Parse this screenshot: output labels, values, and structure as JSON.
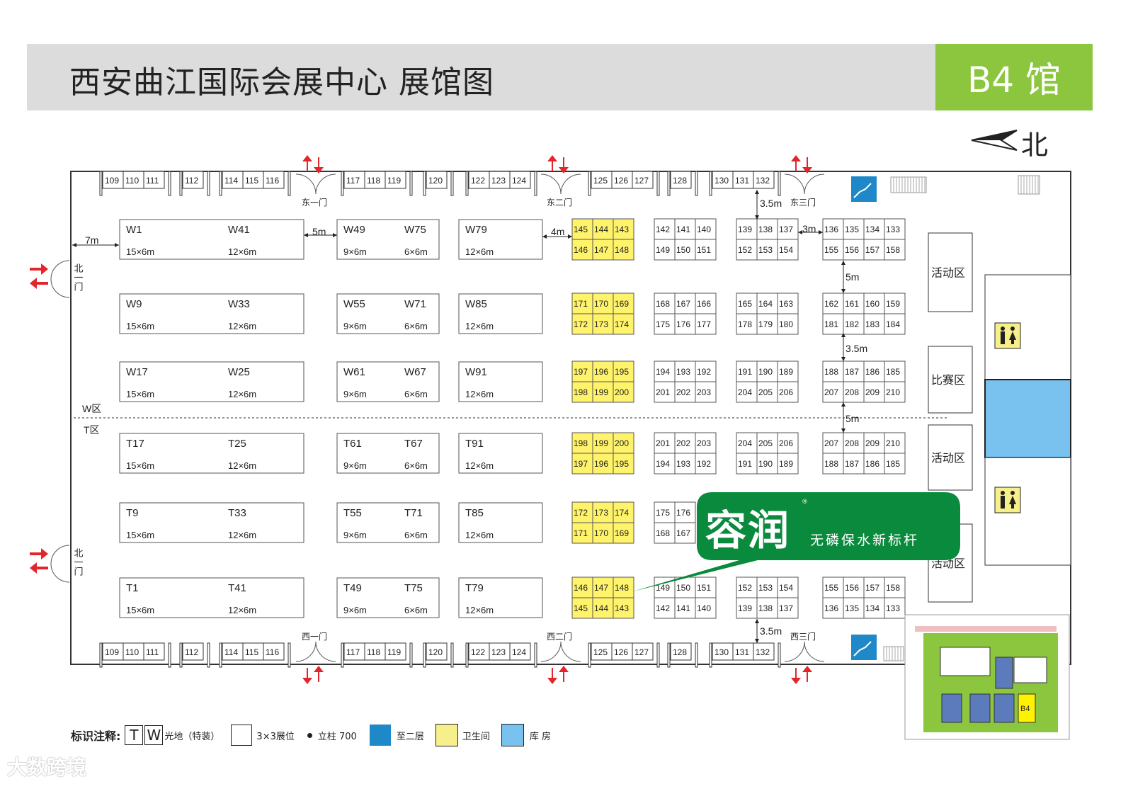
{
  "header": {
    "title": "西安曲江国际会展中心 展馆图",
    "hall": "B4 馆",
    "north_label": "北"
  },
  "colors": {
    "accent_green": "#8cc63f",
    "header_gray": "#dcdcdc",
    "booth_yellow": "#fff36b",
    "storage_blue": "#79c1ef",
    "stair_blue": "#1e88c8",
    "door_red": "#e3262b",
    "ad_green": "#0a8a3c"
  },
  "edge_booths": {
    "groups": [
      [
        "109",
        "110",
        "111"
      ],
      [
        "112"
      ],
      [
        "114",
        "115",
        "116"
      ],
      [
        "117",
        "118",
        "119"
      ],
      [
        "120"
      ],
      [
        "122",
        "123",
        "124"
      ],
      [
        "125",
        "126",
        "127"
      ],
      [
        "128"
      ],
      [
        "130",
        "131",
        "132"
      ]
    ]
  },
  "doors": {
    "east": [
      "东一门",
      "东二门",
      "东三门"
    ],
    "west": [
      "西一门",
      "西二门",
      "西三门"
    ],
    "north": [
      "北一门",
      "北一门"
    ]
  },
  "distances": {
    "d7": "7m",
    "d5": "5m",
    "d4": "4m",
    "d35": "3.5m",
    "d3": "3m"
  },
  "zones": {
    "w_label": "W区",
    "t_label": "T区",
    "activity": "活动区",
    "competition": "比赛区"
  },
  "large_booths": [
    [
      {
        "id": "W1",
        "size": "15×6m"
      },
      {
        "id": "W41",
        "size": "12×6m"
      },
      {
        "id": "W49",
        "size": "9×6m"
      },
      {
        "id": "W75",
        "size": "6×6m"
      },
      {
        "id": "W79",
        "size": "12×6m"
      }
    ],
    [
      {
        "id": "W9",
        "size": "15×6m"
      },
      {
        "id": "W33",
        "size": "12×6m"
      },
      {
        "id": "W55",
        "size": "9×6m"
      },
      {
        "id": "W71",
        "size": "6×6m"
      },
      {
        "id": "W85",
        "size": "12×6m"
      }
    ],
    [
      {
        "id": "W17",
        "size": "15×6m"
      },
      {
        "id": "W25",
        "size": "12×6m"
      },
      {
        "id": "W61",
        "size": "9×6m"
      },
      {
        "id": "W67",
        "size": "6×6m"
      },
      {
        "id": "W91",
        "size": "12×6m"
      }
    ],
    [
      {
        "id": "T17",
        "size": "15×6m"
      },
      {
        "id": "T25",
        "size": "12×6m"
      },
      {
        "id": "T61",
        "size": "9×6m"
      },
      {
        "id": "T67",
        "size": "6×6m"
      },
      {
        "id": "T91",
        "size": "12×6m"
      }
    ],
    [
      {
        "id": "T9",
        "size": "15×6m"
      },
      {
        "id": "T33",
        "size": "12×6m"
      },
      {
        "id": "T55",
        "size": "9×6m"
      },
      {
        "id": "T71",
        "size": "6×6m"
      },
      {
        "id": "T85",
        "size": "12×6m"
      }
    ],
    [
      {
        "id": "T1",
        "size": "15×6m"
      },
      {
        "id": "T41",
        "size": "12×6m"
      },
      {
        "id": "T49",
        "size": "9×6m"
      },
      {
        "id": "T75",
        "size": "6×6m"
      },
      {
        "id": "T79",
        "size": "12×6m"
      }
    ]
  ],
  "small_booth_rows": [
    [
      [
        [
          "145",
          "144",
          "143"
        ],
        [
          "146",
          "147",
          "148"
        ]
      ],
      [
        [
          "142",
          "141",
          "140"
        ],
        [
          "149",
          "150",
          "151"
        ]
      ],
      [
        [
          "139",
          "138",
          "137"
        ],
        [
          "152",
          "153",
          "154"
        ]
      ],
      [
        [
          "136",
          "135",
          "134",
          "133"
        ],
        [
          "155",
          "156",
          "157",
          "158"
        ]
      ]
    ],
    [
      [
        [
          "171",
          "170",
          "169"
        ],
        [
          "172",
          "173",
          "174"
        ]
      ],
      [
        [
          "168",
          "167",
          "166"
        ],
        [
          "175",
          "176",
          "177"
        ]
      ],
      [
        [
          "165",
          "164",
          "163"
        ],
        [
          "178",
          "179",
          "180"
        ]
      ],
      [
        [
          "162",
          "161",
          "160",
          "159"
        ],
        [
          "181",
          "182",
          "183",
          "184"
        ]
      ]
    ],
    [
      [
        [
          "197",
          "196",
          "195"
        ],
        [
          "198",
          "199",
          "200"
        ]
      ],
      [
        [
          "194",
          "193",
          "192"
        ],
        [
          "201",
          "202",
          "203"
        ]
      ],
      [
        [
          "191",
          "190",
          "189"
        ],
        [
          "204",
          "205",
          "206"
        ]
      ],
      [
        [
          "188",
          "187",
          "186",
          "185"
        ],
        [
          "207",
          "208",
          "209",
          "210"
        ]
      ]
    ],
    [
      [
        [
          "198",
          "199",
          "200"
        ],
        [
          "197",
          "196",
          "195"
        ]
      ],
      [
        [
          "201",
          "202",
          "203"
        ],
        [
          "194",
          "193",
          "192"
        ]
      ],
      [
        [
          "204",
          "205",
          "206"
        ],
        [
          "191",
          "190",
          "189"
        ]
      ],
      [
        [
          "207",
          "208",
          "209",
          "210"
        ],
        [
          "188",
          "187",
          "186",
          "185"
        ]
      ]
    ],
    [
      [
        [
          "172",
          "173",
          "174"
        ],
        [
          "171",
          "170",
          "169"
        ]
      ],
      [
        [
          "175",
          "176"
        ],
        [
          "168",
          "167"
        ]
      ],
      [],
      []
    ],
    [
      [
        [
          "146",
          "147",
          "148"
        ],
        [
          "145",
          "144",
          "143"
        ]
      ],
      [
        [
          "149",
          "150",
          "151"
        ],
        [
          "142",
          "141",
          "140"
        ]
      ],
      [
        [
          "152",
          "153",
          "154"
        ],
        [
          "139",
          "138",
          "137"
        ]
      ],
      [
        [
          "155",
          "156",
          "157",
          "158"
        ],
        [
          "136",
          "135",
          "134",
          "133"
        ]
      ]
    ]
  ],
  "ad": {
    "brand": "容润",
    "slogan": "无磷保水新标杆",
    "reg": "®"
  },
  "legend": {
    "title": "标识注释:",
    "t": "T",
    "w": "W",
    "raw_space": "光地（特装）",
    "std_booth": "3×3展位",
    "column": "立柱 700",
    "stairs": "至二层",
    "restroom": "卫生间",
    "storage": "库 房"
  },
  "watermark": "大数跨境",
  "inset_map_label": "B4"
}
